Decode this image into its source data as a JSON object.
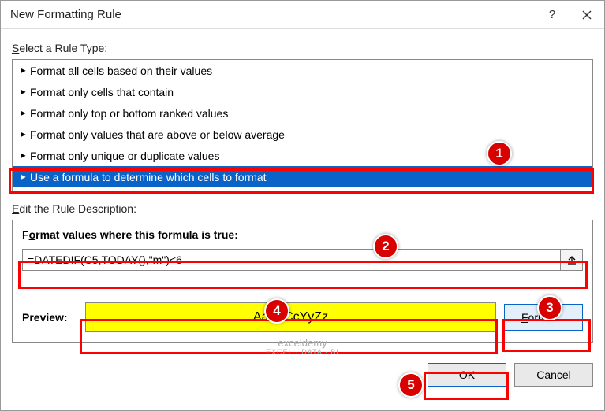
{
  "titlebar": {
    "title": "New Formatting Rule"
  },
  "labels": {
    "select_rule_type": "Select a Rule Type:",
    "edit_rule_desc": "Edit the Rule Description:",
    "format_values": "Format values where this formula is true:",
    "preview": "Preview:"
  },
  "rules": {
    "items": [
      {
        "label": "Format all cells based on their values"
      },
      {
        "label": "Format only cells that contain"
      },
      {
        "label": "Format only top or bottom ranked values"
      },
      {
        "label": "Format only values that are above or below average"
      },
      {
        "label": "Format only unique or duplicate values"
      },
      {
        "label": "Use a formula to determine which cells to format"
      }
    ],
    "selected_index": 5
  },
  "formula": {
    "value": "=DATEDIF(C5,TODAY(),\"m\")<6"
  },
  "preview": {
    "sample_text": "AaBbCcYyZz",
    "bg_color": "#ffff00"
  },
  "buttons": {
    "format": "Format...",
    "ok": "OK",
    "cancel": "Cancel"
  },
  "annotations": {
    "b1": "1",
    "b2": "2",
    "b3": "3",
    "b4": "4",
    "b5": "5"
  },
  "watermark": {
    "main": "exceldemy",
    "sub": "EXCEL · DATA · BI"
  }
}
